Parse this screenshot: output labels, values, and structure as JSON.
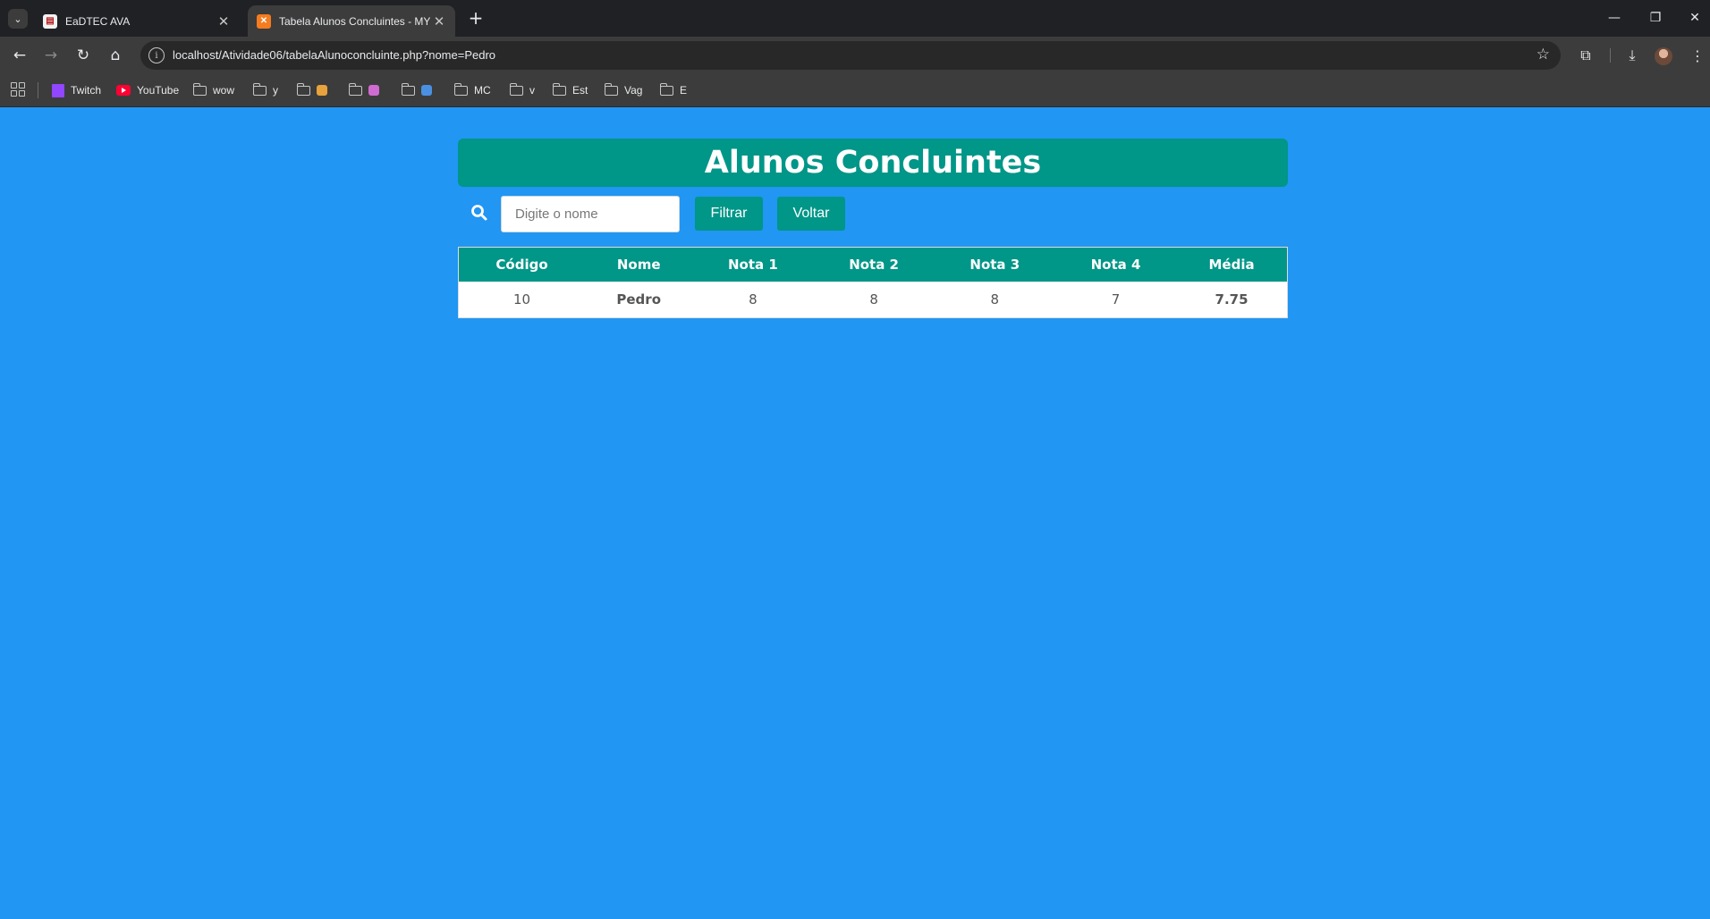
{
  "browser": {
    "tabs": [
      {
        "title": "EaDTEC AVA",
        "active": false
      },
      {
        "title": "Tabela Alunos Concluintes - MY",
        "active": true
      }
    ],
    "url": "localhost/Atividade06/tabelaAlunoconcluinte.php?nome=Pedro",
    "bookmarks": [
      "Twitch",
      "YouTube",
      "wow",
      "y",
      "",
      "",
      "MC",
      "v",
      "Est",
      "Vag",
      "E"
    ]
  },
  "page": {
    "title": "Alunos Concluintes",
    "search_placeholder": "Digite o nome",
    "filter_label": "Filtrar",
    "back_label": "Voltar"
  },
  "table": {
    "headers": [
      "Código",
      "Nome",
      "Nota 1",
      "Nota 2",
      "Nota 3",
      "Nota 4",
      "Média"
    ],
    "rows": [
      [
        "10",
        "Pedro",
        "8",
        "8",
        "8",
        "7",
        "7.75"
      ]
    ]
  },
  "colors": {
    "page_background": "#2196f3",
    "accent": "#009688"
  },
  "icons": [
    "search-icon",
    "info-icon",
    "star-icon",
    "extensions-icon",
    "download-icon",
    "folder-icon"
  ]
}
